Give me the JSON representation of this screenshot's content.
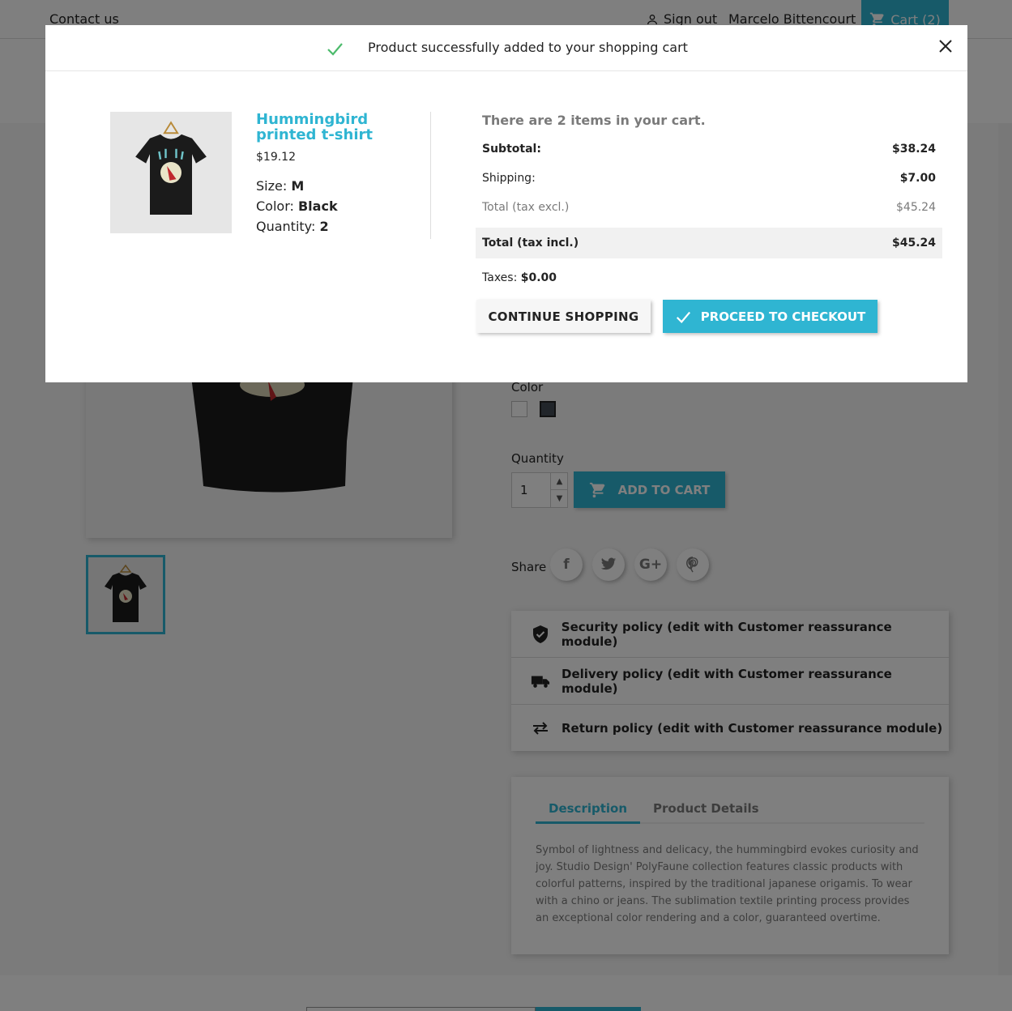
{
  "header": {
    "contact_label": "Contact us",
    "signout_label": "Sign out",
    "user_name": "Marcelo Bittencourt",
    "cart_label": "Cart (2)"
  },
  "product_page": {
    "color_label": "Color",
    "quantity_label": "Quantity",
    "quantity_value": "1",
    "add_to_cart_label": "ADD TO CART",
    "share_label": "Share",
    "reassurance": [
      {
        "icon": "shield-check-icon",
        "label": "Security policy (edit with Customer reassurance module)"
      },
      {
        "icon": "truck-icon",
        "label": "Delivery policy (edit with Customer reassurance module)"
      },
      {
        "icon": "swap-arrows-icon",
        "label": "Return policy (edit with Customer reassurance module)"
      }
    ],
    "tabs": [
      {
        "label": "Description",
        "active": true
      },
      {
        "label": "Product Details",
        "active": false
      }
    ],
    "description": "Symbol of lightness and delicacy, the hummingbird evokes curiosity and joy. Studio Design' PolyFaune collection features classic products with colorful patterns, inspired by the traditional japanese origamis. To wear with a chino or jeans. The sublimation textile printing process provides an exceptional color rendering and a color, guaranteed overtime."
  },
  "modal": {
    "title": "Product successfully added to your shopping cart",
    "product": {
      "name": "Hummingbird printed t-shirt",
      "price": "$19.12",
      "size_label": "Size:",
      "size_value": "M",
      "color_label": "Color:",
      "color_value": "Black",
      "quantity_label": "Quantity:",
      "quantity_value": "2"
    },
    "cart_count_text": "There are 2 items in your cart.",
    "subtotal_label": "Subtotal:",
    "subtotal_value": "$38.24",
    "shipping_label": "Shipping:",
    "shipping_value": "$7.00",
    "total_excl_label": "Total (tax excl.)",
    "total_excl_value": "$45.24",
    "total_incl_label": "Total (tax incl.)",
    "total_incl_value": "$45.24",
    "taxes_label": "Taxes:",
    "taxes_value": "$0.00",
    "continue_label": "CONTINUE SHOPPING",
    "checkout_label": "PROCEED TO CHECKOUT"
  },
  "colors": {
    "accent": "#2fb5d2",
    "success": "#4cbb6c"
  }
}
